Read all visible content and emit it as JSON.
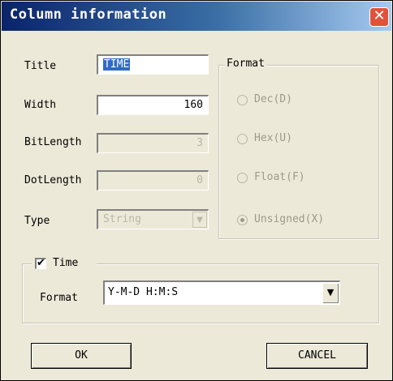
{
  "window": {
    "title": "Column information",
    "close_glyph": "✕"
  },
  "fields": {
    "title": {
      "label": "Title",
      "value": "TIME"
    },
    "width": {
      "label": "Width",
      "value": "160"
    },
    "bitlength": {
      "label": "BitLength",
      "value": "3"
    },
    "dotlength": {
      "label": "DotLength",
      "value": "0"
    },
    "type": {
      "label": "Type",
      "value": "String"
    }
  },
  "format_group": {
    "label": "Format",
    "options": [
      {
        "label": "Dec(D)",
        "checked": false
      },
      {
        "label": "Hex(U)",
        "checked": false
      },
      {
        "label": "Float(F)",
        "checked": false
      },
      {
        "label": "Unsigned(X)",
        "checked": true
      }
    ]
  },
  "time_group": {
    "checkbox_label": "Time",
    "checked": true,
    "format_label": "Format",
    "format_value": "Y-M-D H:M:S"
  },
  "buttons": {
    "ok": "OK",
    "cancel": "CANCEL"
  },
  "colors": {
    "titlebar_start": "#0a246a",
    "titlebar_end": "#a6caf0",
    "dialog_bg": "#ece9d8",
    "close": "#e0533a"
  }
}
